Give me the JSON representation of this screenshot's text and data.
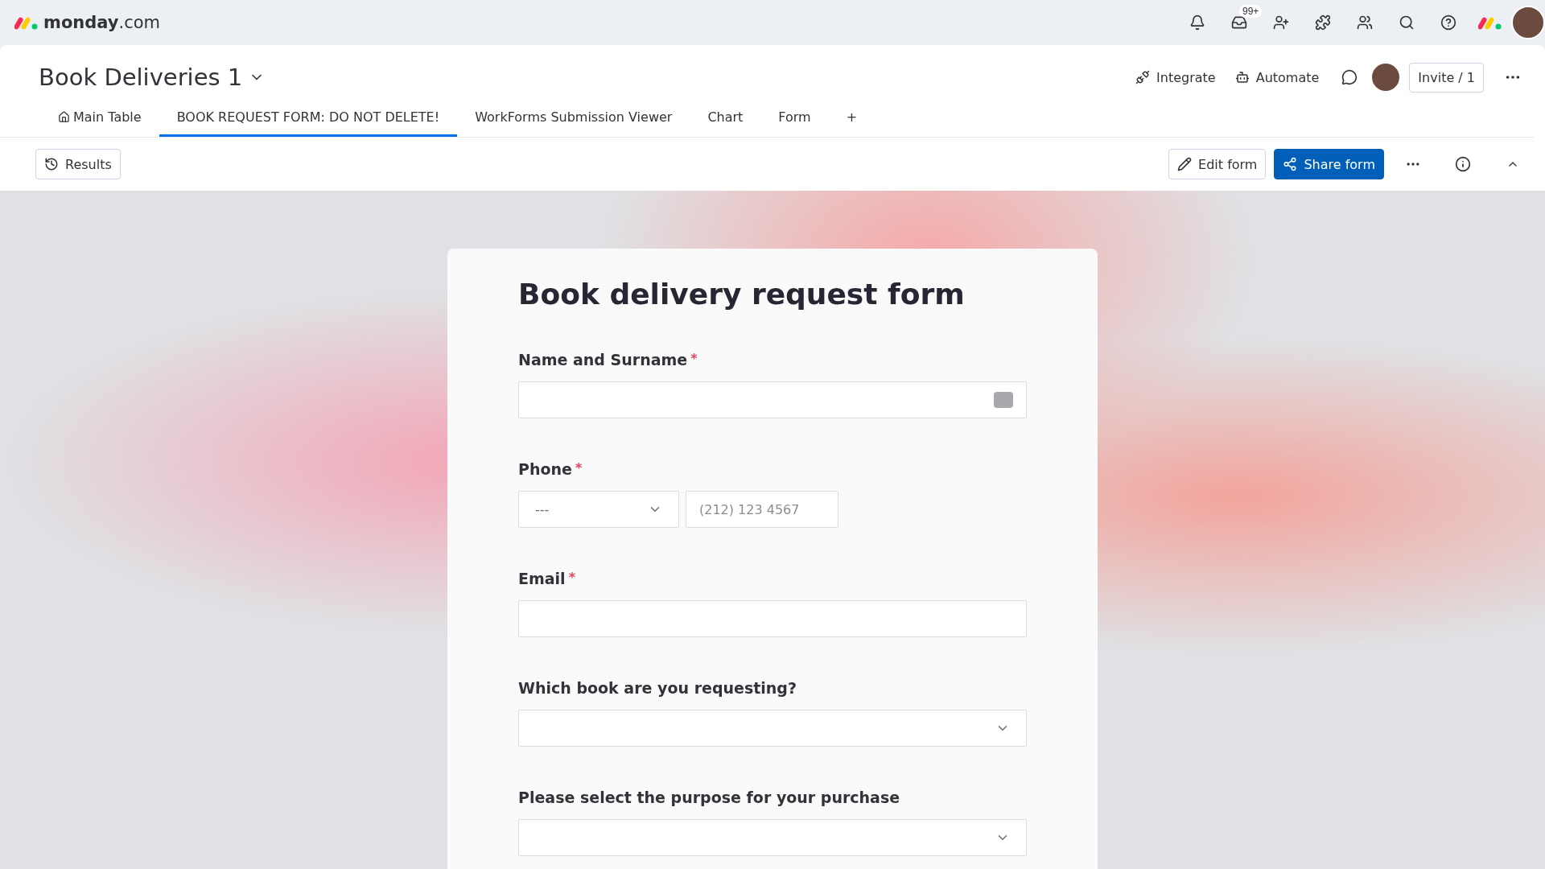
{
  "app": {
    "logo_text": "monday",
    "logo_suffix": ".com",
    "inbox_badge": "99+"
  },
  "board": {
    "title": "Book Deliveries 1",
    "actions": [
      "Integrate",
      "Automate"
    ],
    "invite": "Invite / 1"
  },
  "tabs": [
    {
      "label": "Main Table",
      "selected": false,
      "kind": "home"
    },
    {
      "label": "BOOK REQUEST FORM: DO NOT DELETE!",
      "selected": true,
      "kind": "plain"
    },
    {
      "label": "WorkForms Submission Viewer",
      "selected": false,
      "kind": "plain"
    },
    {
      "label": "Chart",
      "selected": false,
      "kind": "plain"
    },
    {
      "label": "Form",
      "selected": false,
      "kind": "plain"
    },
    {
      "label": "+",
      "selected": false,
      "kind": "add"
    }
  ],
  "toolbar": {
    "results": "Results",
    "edit": "Edit form",
    "share": "Share form"
  },
  "form": {
    "title": "Book delivery request form",
    "fields": [
      {
        "kind": "text",
        "label": "Name and Surname",
        "mark": "*"
      },
      {
        "kind": "phone",
        "label": "Phone",
        "mark": "*",
        "country": "---",
        "placeholder": "(212) 123 4567"
      },
      {
        "kind": "email",
        "label": "Email",
        "mark": "*"
      },
      {
        "kind": "select",
        "label": "Which book are you requesting?"
      },
      {
        "kind": "select",
        "label": "Please select the purpose for your purchase"
      }
    ]
  }
}
